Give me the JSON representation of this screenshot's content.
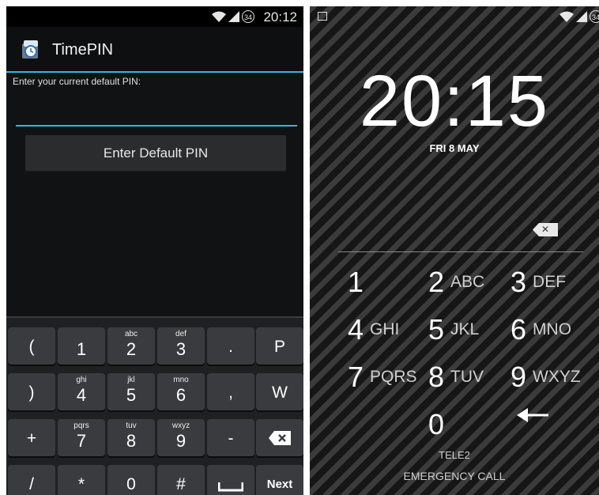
{
  "left": {
    "status": {
      "badge": "34",
      "time": "20:12"
    },
    "app_title": "TimePIN",
    "prompt": "Enter your current default PIN:",
    "pin_value": "",
    "button_label": "Enter Default PIN",
    "keyboard": {
      "row1": [
        {
          "main": "(",
          "sub": ""
        },
        {
          "main": "1",
          "sub": ""
        },
        {
          "main": "2",
          "sub": "abc"
        },
        {
          "main": "3",
          "sub": "def"
        },
        {
          "main": ".",
          "sub": ""
        },
        {
          "main": "P",
          "sub": ""
        }
      ],
      "row2": [
        {
          "main": ")",
          "sub": ""
        },
        {
          "main": "4",
          "sub": "ghi"
        },
        {
          "main": "5",
          "sub": "jkl"
        },
        {
          "main": "6",
          "sub": "mno"
        },
        {
          "main": ",",
          "sub": ""
        },
        {
          "main": "W",
          "sub": ""
        }
      ],
      "row3": [
        {
          "main": "+",
          "sub": ""
        },
        {
          "main": "7",
          "sub": "pqrs"
        },
        {
          "main": "8",
          "sub": "tuv"
        },
        {
          "main": "9",
          "sub": "wxyz"
        },
        {
          "main": "-",
          "sub": ""
        },
        {
          "main": "",
          "sub": ""
        }
      ],
      "row4": [
        {
          "main": "/",
          "sub": ""
        },
        {
          "main": "*",
          "sub": ""
        },
        {
          "main": "0",
          "sub": ""
        },
        {
          "main": "#",
          "sub": ""
        },
        {
          "main": "",
          "sub": ""
        },
        {
          "main": "Next",
          "sub": ""
        }
      ]
    }
  },
  "right": {
    "status": {
      "badge": "34"
    },
    "time": "20:15",
    "date": "FRI 8 MAY",
    "keypad": [
      {
        "n": "1",
        "l": ""
      },
      {
        "n": "2",
        "l": "ABC"
      },
      {
        "n": "3",
        "l": "DEF"
      },
      {
        "n": "4",
        "l": "GHI"
      },
      {
        "n": "5",
        "l": "JKL"
      },
      {
        "n": "6",
        "l": "MNO"
      },
      {
        "n": "7",
        "l": "PQRS"
      },
      {
        "n": "8",
        "l": "TUV"
      },
      {
        "n": "9",
        "l": "WXYZ"
      },
      {
        "n": "0",
        "l": ""
      }
    ],
    "carrier": "TELE2",
    "emergency": "EMERGENCY CALL"
  },
  "colors": {
    "accent": "#33b5e5",
    "key": "#3a3b3e",
    "keyboard_bg": "#1f2022"
  }
}
